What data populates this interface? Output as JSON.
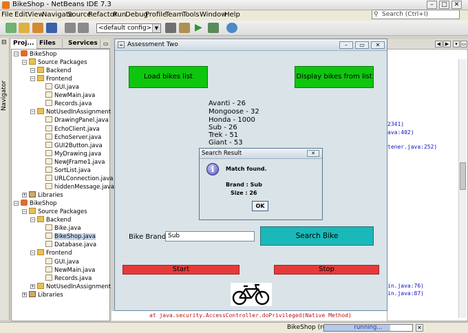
{
  "app": {
    "title": "BikeShop - NetBeans IDE 7.3"
  },
  "menu": [
    "File",
    "Edit",
    "View",
    "Navigate",
    "Source",
    "Refactor",
    "Run",
    "Debug",
    "Profile",
    "Team",
    "Tools",
    "Window",
    "Help"
  ],
  "search": {
    "placeholder": "Search (Ctrl+I)"
  },
  "toolbar": {
    "config": "<default config>"
  },
  "navigator": {
    "label": "Navigator"
  },
  "panel_tabs": [
    "Proj...",
    "Files",
    "Services"
  ],
  "tree": [
    {
      "label": "BikeShop",
      "icon": "project-icon",
      "depth": 0
    },
    {
      "label": "Source Packages",
      "icon": "package-icon",
      "depth": 1
    },
    {
      "label": "Backend",
      "icon": "package-icon",
      "depth": 2
    },
    {
      "label": "Frontend",
      "icon": "package-icon",
      "depth": 2
    },
    {
      "label": "GUI.java",
      "icon": "java-file-icon",
      "depth": 3
    },
    {
      "label": "NewMain.java",
      "icon": "java-file-icon",
      "depth": 3
    },
    {
      "label": "Records.java",
      "icon": "java-file-icon",
      "depth": 3
    },
    {
      "label": "NotUsedInAssignment",
      "icon": "package-icon",
      "depth": 2
    },
    {
      "label": "DrawingPanel.java",
      "icon": "java-file-icon",
      "depth": 3
    },
    {
      "label": "EchoClient.java",
      "icon": "java-file-icon",
      "depth": 3
    },
    {
      "label": "EchoServer.java",
      "icon": "java-file-icon",
      "depth": 3
    },
    {
      "label": "GUI2Button.java",
      "icon": "java-file-icon",
      "depth": 3
    },
    {
      "label": "MyDrawing.java",
      "icon": "java-file-icon",
      "depth": 3
    },
    {
      "label": "NewJFrame1.java",
      "icon": "java-file-icon",
      "depth": 3
    },
    {
      "label": "SortList.java",
      "icon": "java-file-icon",
      "depth": 3
    },
    {
      "label": "URLConnection.java",
      "icon": "java-file-icon",
      "depth": 3
    },
    {
      "label": "hiddenMessage.java",
      "icon": "java-file-icon",
      "depth": 3
    },
    {
      "label": "Libraries",
      "icon": "library-icon",
      "depth": 1
    },
    {
      "label": "BikeShop",
      "icon": "project-icon",
      "depth": 0
    },
    {
      "label": "Source Packages",
      "icon": "package-icon",
      "depth": 1
    },
    {
      "label": "Backend",
      "icon": "package-icon",
      "depth": 2
    },
    {
      "label": "Bike.java",
      "icon": "java-file-icon",
      "depth": 3
    },
    {
      "label": "BikeShop.java",
      "icon": "java-file-icon",
      "depth": 3
    },
    {
      "label": "Database.java",
      "icon": "java-file-icon",
      "depth": 3
    },
    {
      "label": "Frontend",
      "icon": "package-icon",
      "depth": 2
    },
    {
      "label": "GUI.java",
      "icon": "java-file-icon",
      "depth": 3
    },
    {
      "label": "NewMain.java",
      "icon": "java-file-icon",
      "depth": 3
    },
    {
      "label": "Records.java",
      "icon": "java-file-icon",
      "depth": 3
    },
    {
      "label": "NotUsedInAssignment",
      "icon": "package-icon",
      "depth": 2
    },
    {
      "label": "Libraries",
      "icon": "library-icon",
      "depth": 1
    }
  ],
  "output_fragments": [
    "2341)",
    "ava:402)",
    "tener.java:252)",
    "in.java:76)",
    "in.java:87)"
  ],
  "output_bottom": "at java.security.AccessController.doPrivileged(Native Method)",
  "dialog": {
    "title": "Assessment Two",
    "load_button": "Load bikes list",
    "display_button": "Display bikes from list",
    "bikes": [
      "Avanti - 26",
      "Mongoose - 32",
      "Honda - 1000",
      "Sub - 26",
      "Trek - 51",
      "Giant - 53"
    ],
    "brand_label": "Bike Brand",
    "brand_value": "Sub",
    "search_button": "Search Bike",
    "start_button": "Start",
    "stop_button": "Stop"
  },
  "message": {
    "title": "Search Result",
    "line1": "Match found.",
    "line2": "Brand : Sub",
    "line3": "Size : 26",
    "ok": "OK"
  },
  "status": {
    "project": "BikeShop (run)",
    "progress": "running...",
    "progress_fraction": 0.75
  },
  "colors": {
    "green_button": "#0ec60e",
    "search_button": "#1ab8b8",
    "red_button": "#e63a3a"
  }
}
